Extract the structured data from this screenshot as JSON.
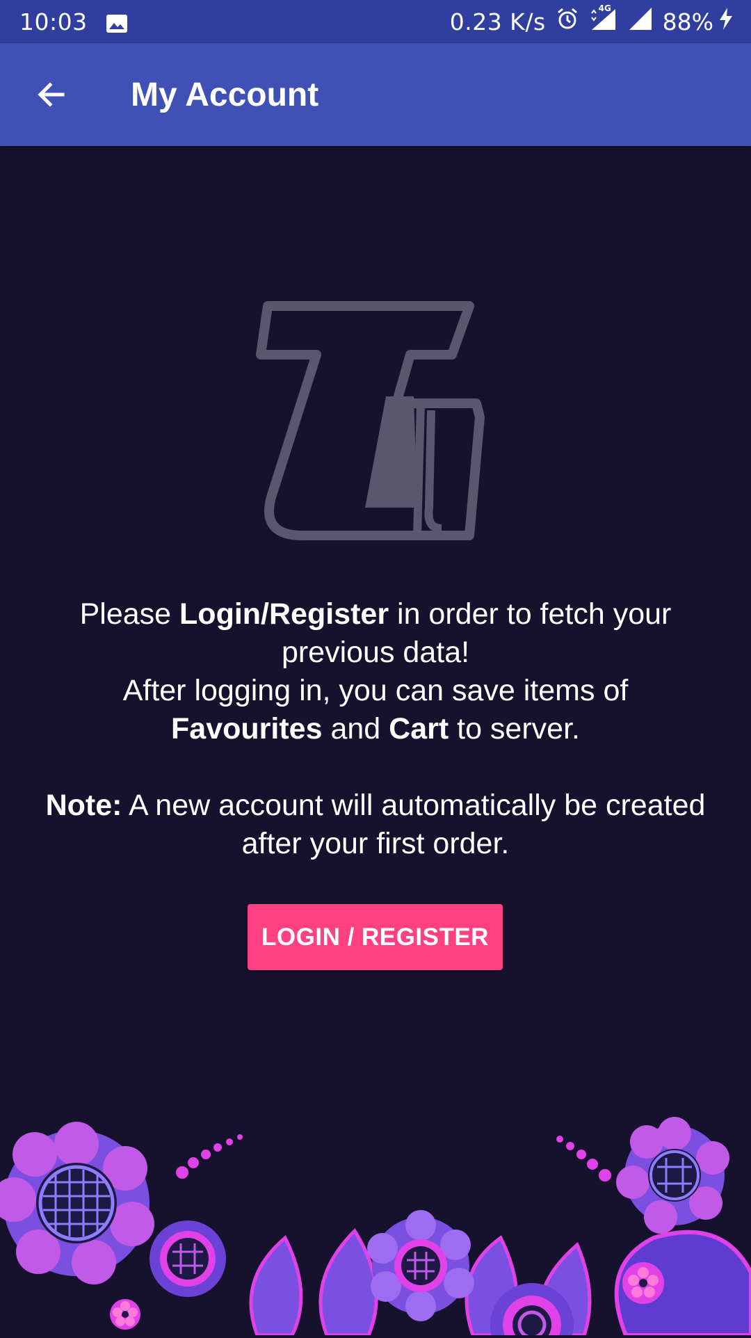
{
  "status_bar": {
    "time": "10:03",
    "speed": "0.23 K/s",
    "network": "4G",
    "battery": "88%",
    "icons": [
      "image-icon",
      "alarm-icon",
      "signal-4g-icon",
      "signal-icon",
      "battery-charging-icon"
    ]
  },
  "app_bar": {
    "title": "My Account",
    "back_icon": "arrow-back-icon"
  },
  "message": {
    "line1_pre": "Please ",
    "line1_bold": "Login/Register",
    "line1_post": " in order to fetch your previous data!",
    "line2": "After logging in, you can save items of",
    "line3_bold1": "Favourites",
    "line3_mid": " and ",
    "line3_bold2": "Cart",
    "line3_post": " to server.",
    "note_label": "Note:",
    "note_text": " A new account will automatically be created after your first order."
  },
  "login_button": {
    "label": "LOGIN / REGISTER"
  },
  "colors": {
    "background": "#16122d",
    "status_bar": "#303f9f",
    "app_bar": "#3f51b5",
    "accent": "#ff4081",
    "logo": "#5a5670",
    "floral_purple": "#7b4fe0",
    "floral_pink": "#e042e8"
  }
}
